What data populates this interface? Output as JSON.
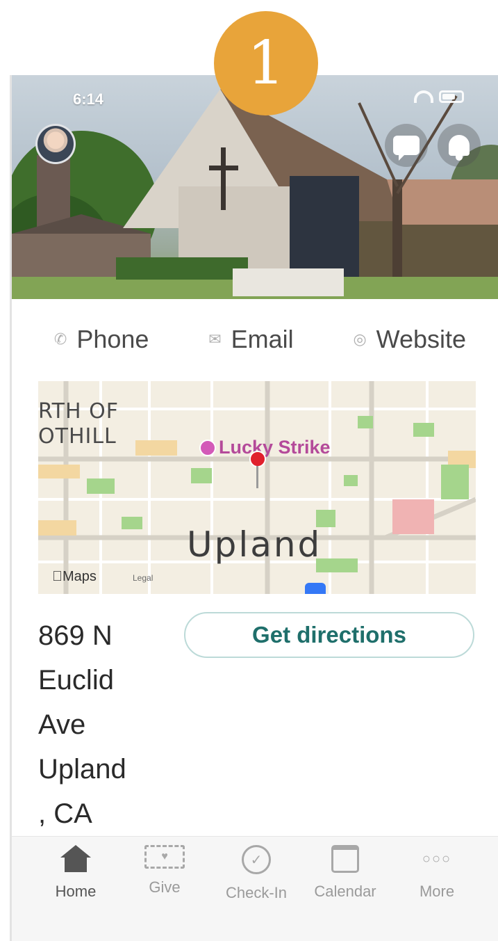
{
  "step_badge": "1",
  "status_bar": {
    "time": "6:14"
  },
  "icons": {
    "avatar": "profile-avatar",
    "chat": "chat-bubble-icon",
    "bell": "bell-icon",
    "phone": "phone-icon",
    "email": "envelope-icon",
    "website": "globe-icon",
    "home": "house-icon",
    "give": "money-icon",
    "checkin": "check-circle-icon",
    "calendar": "calendar-icon",
    "more": "ellipsis-icon"
  },
  "contact": {
    "phone_label": "Phone",
    "email_label": "Email",
    "website_label": "Website"
  },
  "map": {
    "area_label_line1": "RTH OF",
    "area_label_line2": "OTHILL",
    "poi": "Lucky Strike",
    "city": "Upland",
    "attribution": "Maps",
    "legal": "Legal"
  },
  "address": {
    "line1": "869 N",
    "line2": "Euclid",
    "line3": "Ave",
    "line4": "Upland",
    "line5": ", CA"
  },
  "directions_label": "Get directions",
  "tabs": [
    {
      "label": "Home",
      "active": true
    },
    {
      "label": "Give",
      "active": false
    },
    {
      "label": "Check-In",
      "active": false
    },
    {
      "label": "Calendar",
      "active": false
    },
    {
      "label": "More",
      "active": false
    }
  ],
  "colors": {
    "accent": "#1f6f6b",
    "badge": "#e8a43a",
    "poi": "#b44a9a",
    "pin": "#e0202d"
  }
}
